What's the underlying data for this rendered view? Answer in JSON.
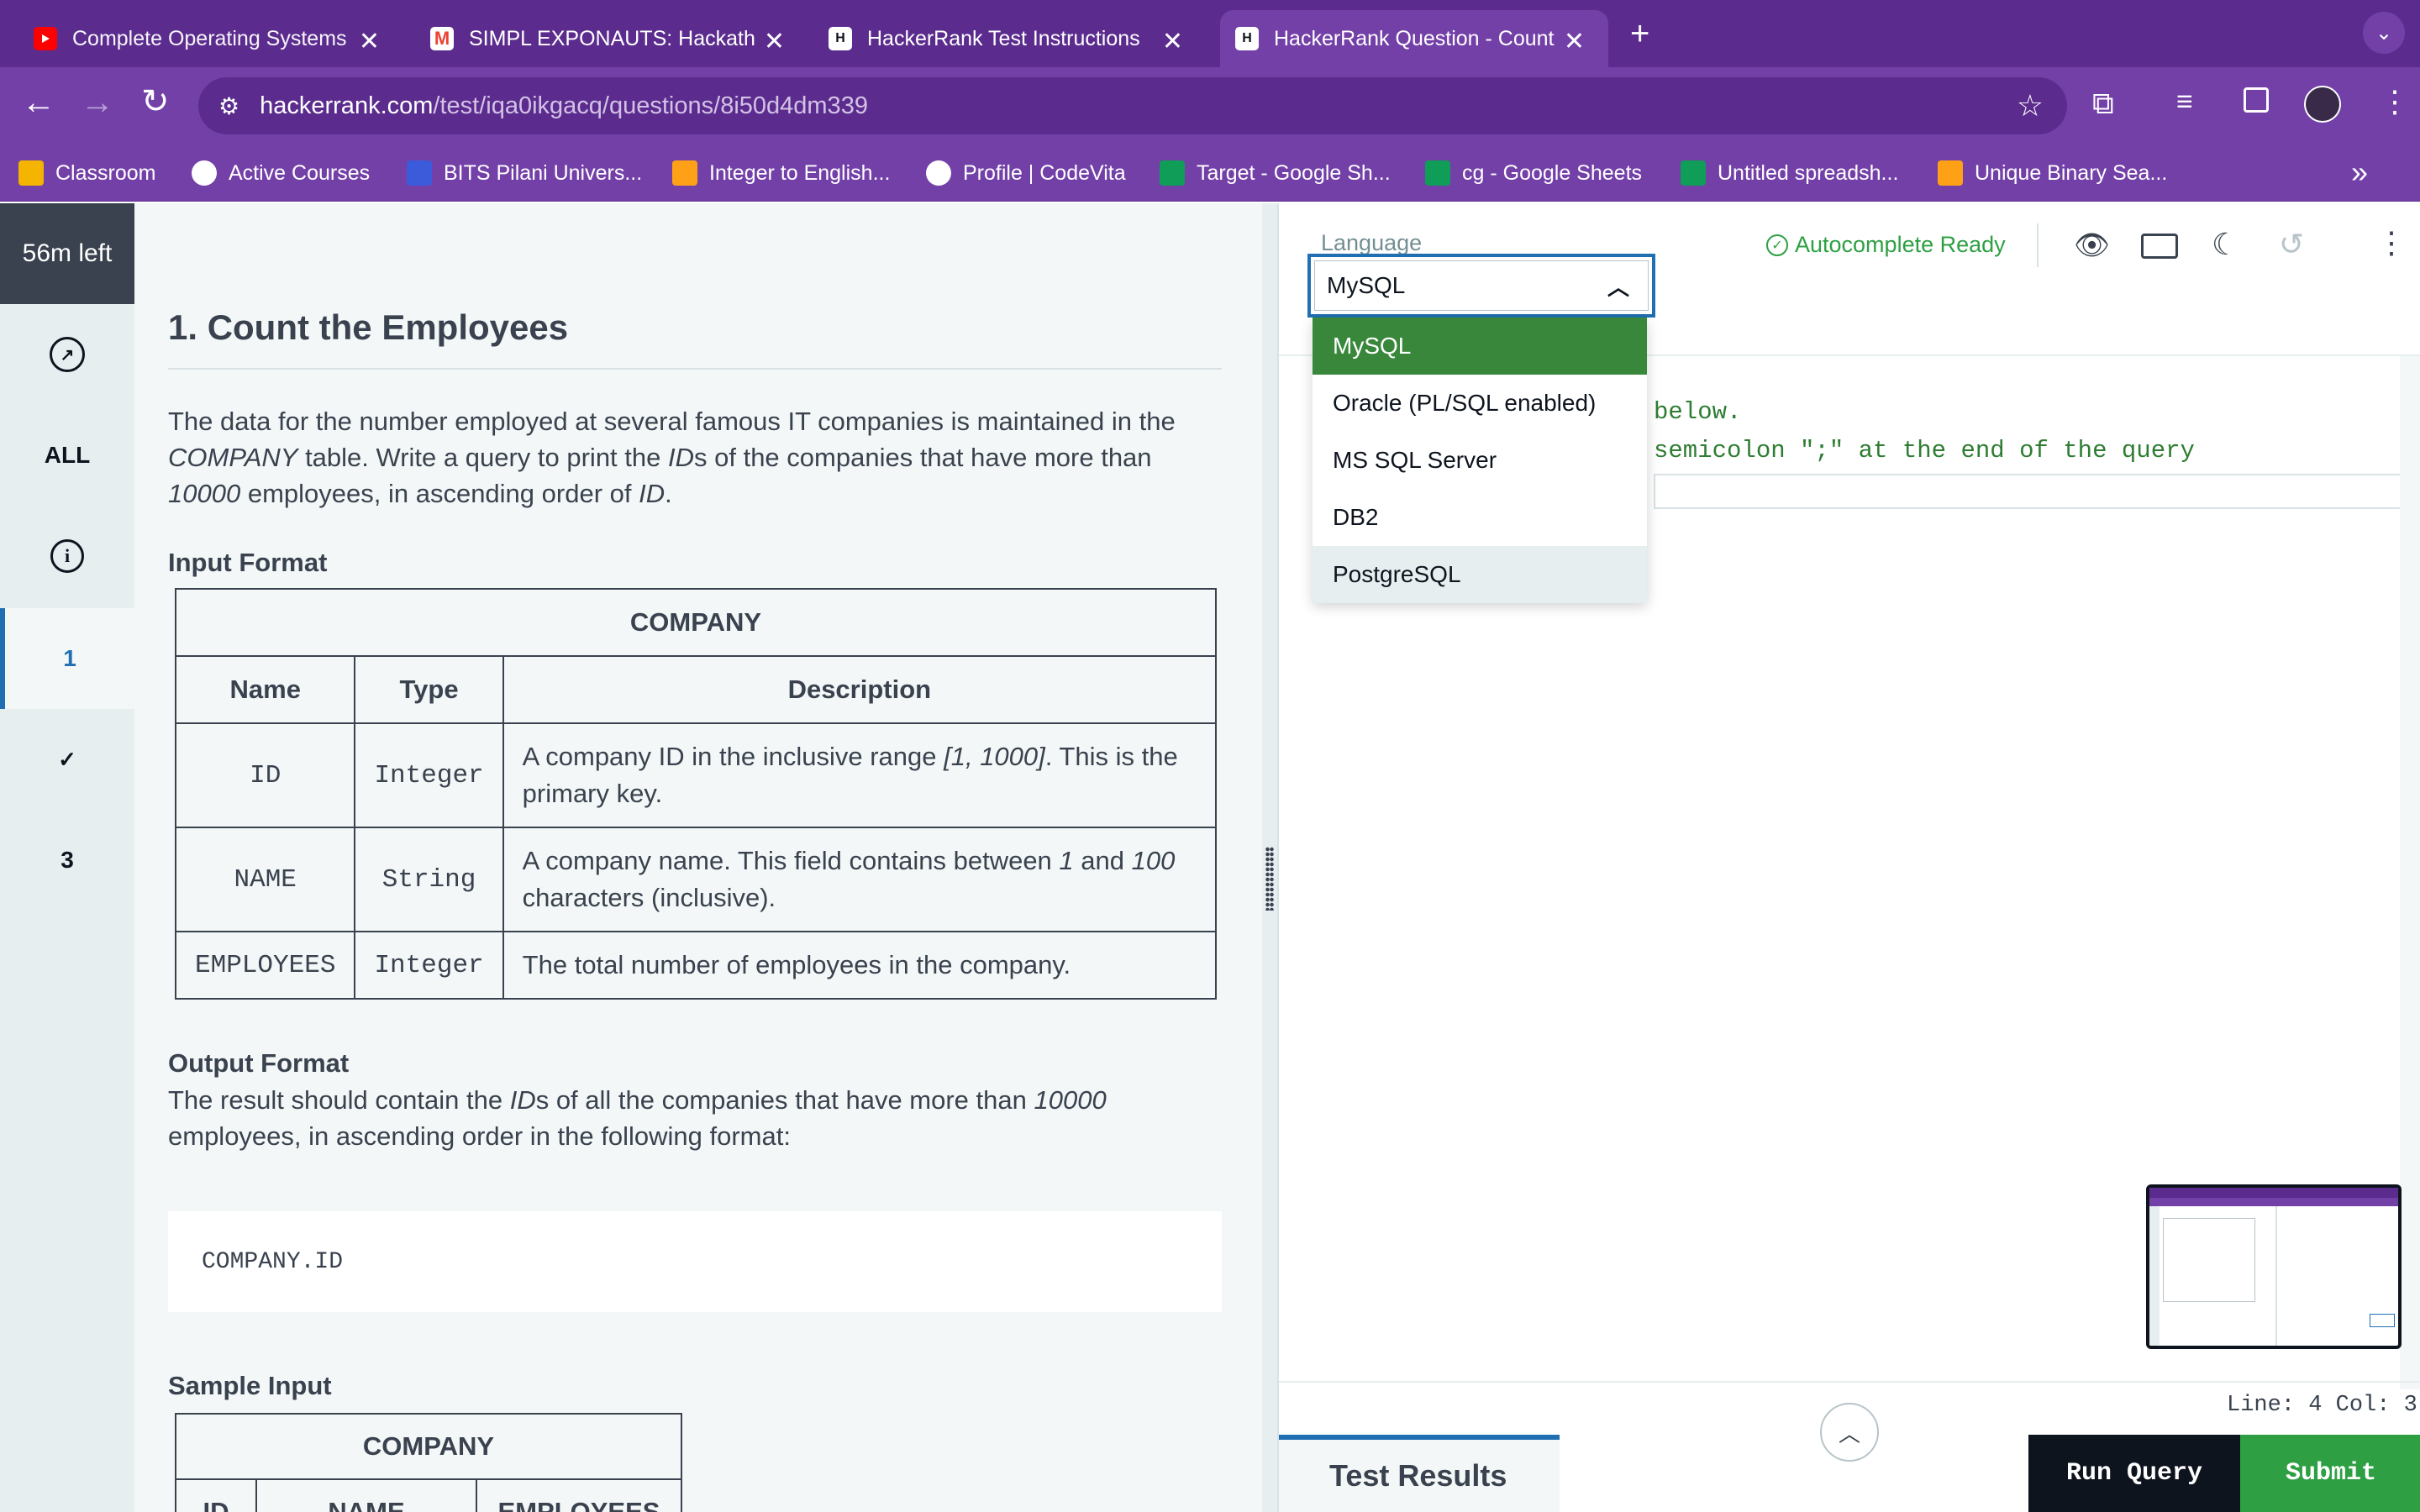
{
  "browser": {
    "tabs": [
      {
        "title": "Complete Operating Systems",
        "icon": "youtube-icon",
        "color": "#ff0000"
      },
      {
        "title": "SIMPL EXPONAUTS: Hackath",
        "icon": "gmail-icon",
        "color": "#ea4335"
      },
      {
        "title": "HackerRank Test Instructions",
        "icon": "hackerrank-icon",
        "color": "#0e141e"
      },
      {
        "title": "HackerRank Question - Count",
        "icon": "hackerrank-icon",
        "color": "#0e141e"
      }
    ],
    "url_domain": "hackerrank.com",
    "url_path": "/test/iqa0ikgacq/questions/8i50d4dm339",
    "bookmarks": [
      {
        "label": "Classroom",
        "color": "#f4b400"
      },
      {
        "label": "Active Courses",
        "color": "#ffffff"
      },
      {
        "label": "BITS Pilani Univers...",
        "color": "#3b5bdb"
      },
      {
        "label": "Integer to English...",
        "color": "#ffa116"
      },
      {
        "label": "Profile | CodeVita",
        "color": "#ffffff"
      },
      {
        "label": "Target - Google Sh...",
        "color": "#0f9d58"
      },
      {
        "label": "cg - Google Sheets",
        "color": "#0f9d58"
      },
      {
        "label": "Untitled spreadsh...",
        "color": "#0f9d58"
      },
      {
        "label": "Unique Binary Sea...",
        "color": "#ffa116"
      }
    ]
  },
  "timer": "56m left",
  "sidebar": {
    "all": "ALL",
    "q1": "1",
    "q3": "3"
  },
  "question": {
    "title": "1. Count the Employees",
    "intro": {
      "p1": "The data for the number employed at several famous IT companies is maintained in the",
      "company": "COMPANY",
      "p2": " table. Write a query to print the ",
      "id": "ID",
      "p3": "s of the companies that have more than",
      "num": "10000",
      "p4": " employees, in ascending order of ",
      "id2": "ID",
      "p5": "."
    },
    "input_format": "Input Format",
    "table": {
      "caption": "COMPANY",
      "headers": [
        "Name",
        "Type",
        "Description"
      ],
      "rows": [
        {
          "name": "ID",
          "type": "Integer",
          "d1": "A company ID in the inclusive range ",
          "d_em": "[1, 1000]",
          "d2": ". This is the primary key."
        },
        {
          "name": "NAME",
          "type": "String",
          "d1": "A company name. This field contains between ",
          "d_em": "1",
          "d_mid": " and ",
          "d_em2": "100",
          "d2": " characters (inclusive)."
        },
        {
          "name": "EMPLOYEES",
          "type": "Integer",
          "d1": "The total number of employees in the company."
        }
      ]
    },
    "output_format": "Output Format",
    "output": {
      "p1": "The result should contain the ",
      "id": "ID",
      "p2": "s of all the companies that have more than ",
      "num": "10000",
      "p3": "employees, in ascending order in the following format:"
    },
    "code_sample": "COMPANY.ID",
    "sample_input": "Sample Input",
    "sample_table": {
      "caption": "COMPANY",
      "headers": [
        "ID",
        "NAME",
        "EMPLOYEES"
      ]
    }
  },
  "editor": {
    "language_label": "Language",
    "selected_language": "MySQL",
    "options": [
      "MySQL",
      "Oracle (PL/SQL enabled)",
      "MS SQL Server",
      "DB2",
      "PostgreSQL"
    ],
    "autocomplete": "Autocomplete Ready",
    "code_line1": "below.",
    "code_line2": "semicolon \";\" at the end of the query",
    "status": "Line: 4 Col: 3",
    "test_results": "Test Results",
    "run_query": "Run Query",
    "submit": "Submit"
  },
  "colors": {
    "accent_green": "#2ea043",
    "selected_option": "#39873a",
    "hover_option": "#e7eef0",
    "focus_blue": "#1f6fb2"
  }
}
